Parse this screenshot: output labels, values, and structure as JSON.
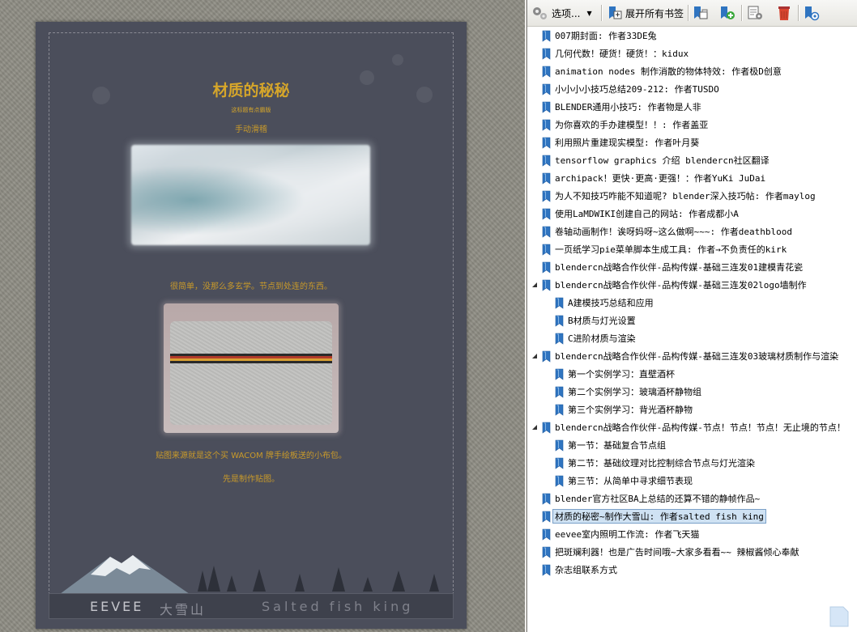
{
  "document": {
    "title": "材质的秘秘",
    "subtitle": "这标题有点霸版",
    "caption1": "手动滑稽",
    "text1": "很简单，没那么多玄学。节点到处连的东西。",
    "text2": "贴图来源就是这个买 WACOM 牌手绘板送的小布包。",
    "text3": "先是制作贴图。",
    "footer_brand": "EEVEE",
    "footer_zh": "大雪山",
    "footer_author": "Salted fish king",
    "image1_icon": "snow-ice-photo",
    "image2_icon": "felt-bag-photo"
  },
  "toolbar": {
    "options_label": "选项...",
    "expand_label": "展开所有书签",
    "icons": [
      "options-gear-icon",
      "expand-all-icon",
      "collapse-icon",
      "new-bookmark-icon",
      "properties-icon",
      "delete-icon",
      "goto-bookmark-icon"
    ]
  },
  "bookmarks": [
    {
      "label": "007期封面: 作者33DE兔",
      "level": 0
    },
    {
      "label": "几何代数！硬货！硬货！：kidux",
      "level": 0
    },
    {
      "label": "animation nodes 制作消散的物体特效: 作者极D创意",
      "level": 0
    },
    {
      "label": "小小小小技巧总结209-212: 作者TUSDO",
      "level": 0
    },
    {
      "label": "BLENDER通用小技巧: 作者物是人非",
      "level": 0
    },
    {
      "label": "为你喜欢的手办建模型！！: 作者盖亚",
      "level": 0
    },
    {
      "label": "利用照片重建现实模型: 作者叶月葵",
      "level": 0
    },
    {
      "label": "tensorflow graphics 介绍 blendercn社区翻译",
      "level": 0
    },
    {
      "label": "archipack！更快·更高·更强！：作者YuKi JuDai",
      "level": 0
    },
    {
      "label": "为人不知技巧咋能不知道呢? blender深入技巧帖: 作者maylog",
      "level": 0
    },
    {
      "label": "使用LaMDWIKI创建自己的网站: 作者成都小A",
      "level": 0
    },
    {
      "label": "卷轴动画制作！诶呀妈呀~这么做啊~~~: 作者deathblood",
      "level": 0
    },
    {
      "label": "一页纸学习pie菜单脚本生成工具: 作者→不负责任的kirk",
      "level": 0
    },
    {
      "label": "blendercn战略合作伙伴-品构传媒-基础三连发01建模青花瓷",
      "level": 0
    },
    {
      "label": "blendercn战略合作伙伴-品构传媒-基础三连发02logo墙制作",
      "level": 0,
      "expanded": true
    },
    {
      "label": "A建模技巧总结和应用",
      "level": 1
    },
    {
      "label": "B材质与灯光设置",
      "level": 1
    },
    {
      "label": "C进阶材质与渲染",
      "level": 1
    },
    {
      "label": "blendercn战略合作伙伴-品构传媒-基础三连发03玻璃材质制作与渲染",
      "level": 0,
      "expanded": true
    },
    {
      "label": "第一个实例学习：直壁酒杯",
      "level": 1
    },
    {
      "label": "第二个实例学习：玻璃酒杯静物组",
      "level": 1
    },
    {
      "label": "第三个实例学习：背光酒杯静物",
      "level": 1
    },
    {
      "label": "blendercn战略合作伙伴-品构传媒-节点！节点！节点！无止境的节点！",
      "level": 0,
      "expanded": true
    },
    {
      "label": "第一节：基础复合节点组",
      "level": 1
    },
    {
      "label": "第二节：基础纹理对比控制综合节点与灯光渲染",
      "level": 1
    },
    {
      "label": "第三节：从简单中寻求细节表现",
      "level": 1
    },
    {
      "label": "blender官方社区BA上总结的还算不错的静帧作品~",
      "level": 0
    },
    {
      "label": "材质的秘密~制作大雪山: 作者salted fish king",
      "level": 0,
      "selected": true
    },
    {
      "label": "eevee室内照明工作流: 作者飞天猫",
      "level": 0
    },
    {
      "label": "把斑斓利器！也是广告时间哦~大家多看看~~ 辣椒酱倾心奉献",
      "level": 0
    },
    {
      "label": "杂志组联系方式",
      "level": 0
    }
  ],
  "colors": {
    "page_bg": "#4b4e5b",
    "title_gold": "#d6a62a",
    "bookmark_blue": "#2f74c0",
    "selection": "#cfe2f3"
  }
}
